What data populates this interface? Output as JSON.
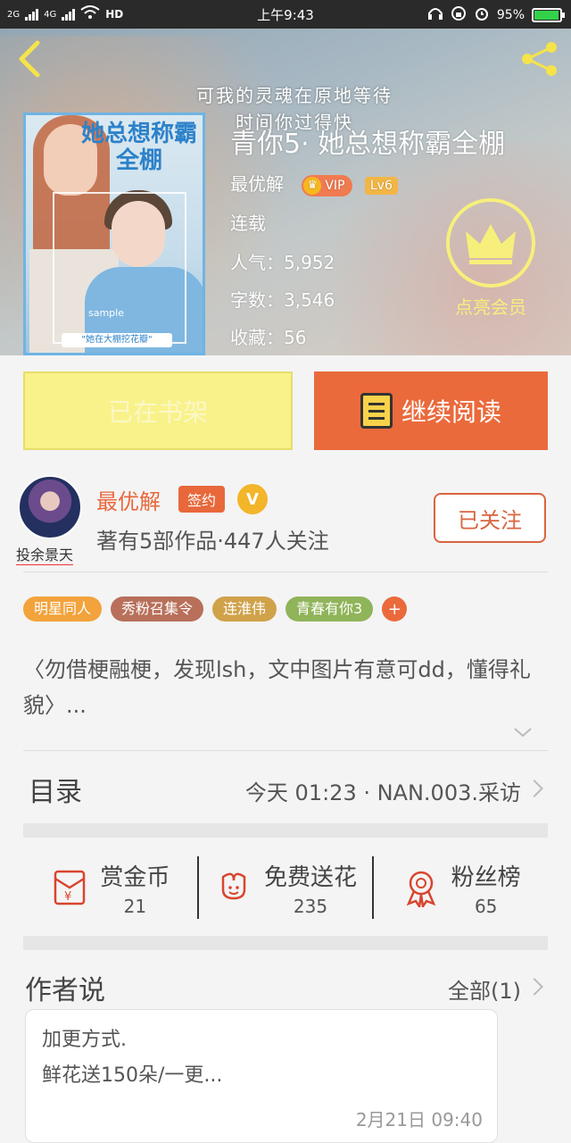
{
  "status_bar": {
    "left": [
      "2G",
      "4G",
      "HD"
    ],
    "time": "上午9:43",
    "battery": "95%",
    "battery_level": 0.95
  },
  "header": {
    "slogan_line1": "可我的灵魂在原地等待",
    "slogan_line2": "时间你过得快",
    "title": "青你5· 她总想称霸全棚",
    "author": "最优解",
    "vip_label": "VIP",
    "level": "Lv6",
    "status": "连载",
    "popularity": "人气：5,952",
    "words": "字数：3,546",
    "favorites": "收藏：56",
    "member_label": "点亮会员"
  },
  "cover": {
    "title": "她总想称霸全棚",
    "sample": "sample",
    "ribbon": "\"她在大棚挖花瓣\""
  },
  "actions": {
    "shelf_label": "已在书架",
    "read_label": "继续阅读"
  },
  "author_block": {
    "name": "最优解",
    "signed": "签约",
    "v_badge": "V",
    "avatar_label": "投余景天",
    "meta": "著有5部作品·447人关注",
    "follow_label": "已关注"
  },
  "tags": [
    {
      "label": "明星同人",
      "color": "#f2a33c"
    },
    {
      "label": "秀粉召集令",
      "color": "#b8705a"
    },
    {
      "label": "连淮伟",
      "color": "#d0a24a"
    },
    {
      "label": "青春有你3",
      "color": "#90b45a"
    }
  ],
  "synopsis": "〈勿借梗融梗，发现lsh，文中图片有意可dd，懂得礼貌〉...",
  "catalog": {
    "label": "目录",
    "latest": "今天 01:23 · NAN.003.采访"
  },
  "stats": [
    {
      "name": "赏金币",
      "value": "21",
      "icon": "red-envelope-icon"
    },
    {
      "name": "免费送花",
      "value": "235",
      "icon": "flower-icon"
    },
    {
      "name": "粉丝榜",
      "value": "65",
      "icon": "medal-icon"
    }
  ],
  "author_says": {
    "title": "作者说",
    "all_label": "全部(1)",
    "line1": "加更方式.",
    "line2": "鲜花送150朵/一更...",
    "date": "2月21日 09:40"
  },
  "colors": {
    "accent_orange": "#ea6a3c",
    "shelf_yellow": "#f9f28a",
    "member_yellow": "#f6ef7c"
  }
}
